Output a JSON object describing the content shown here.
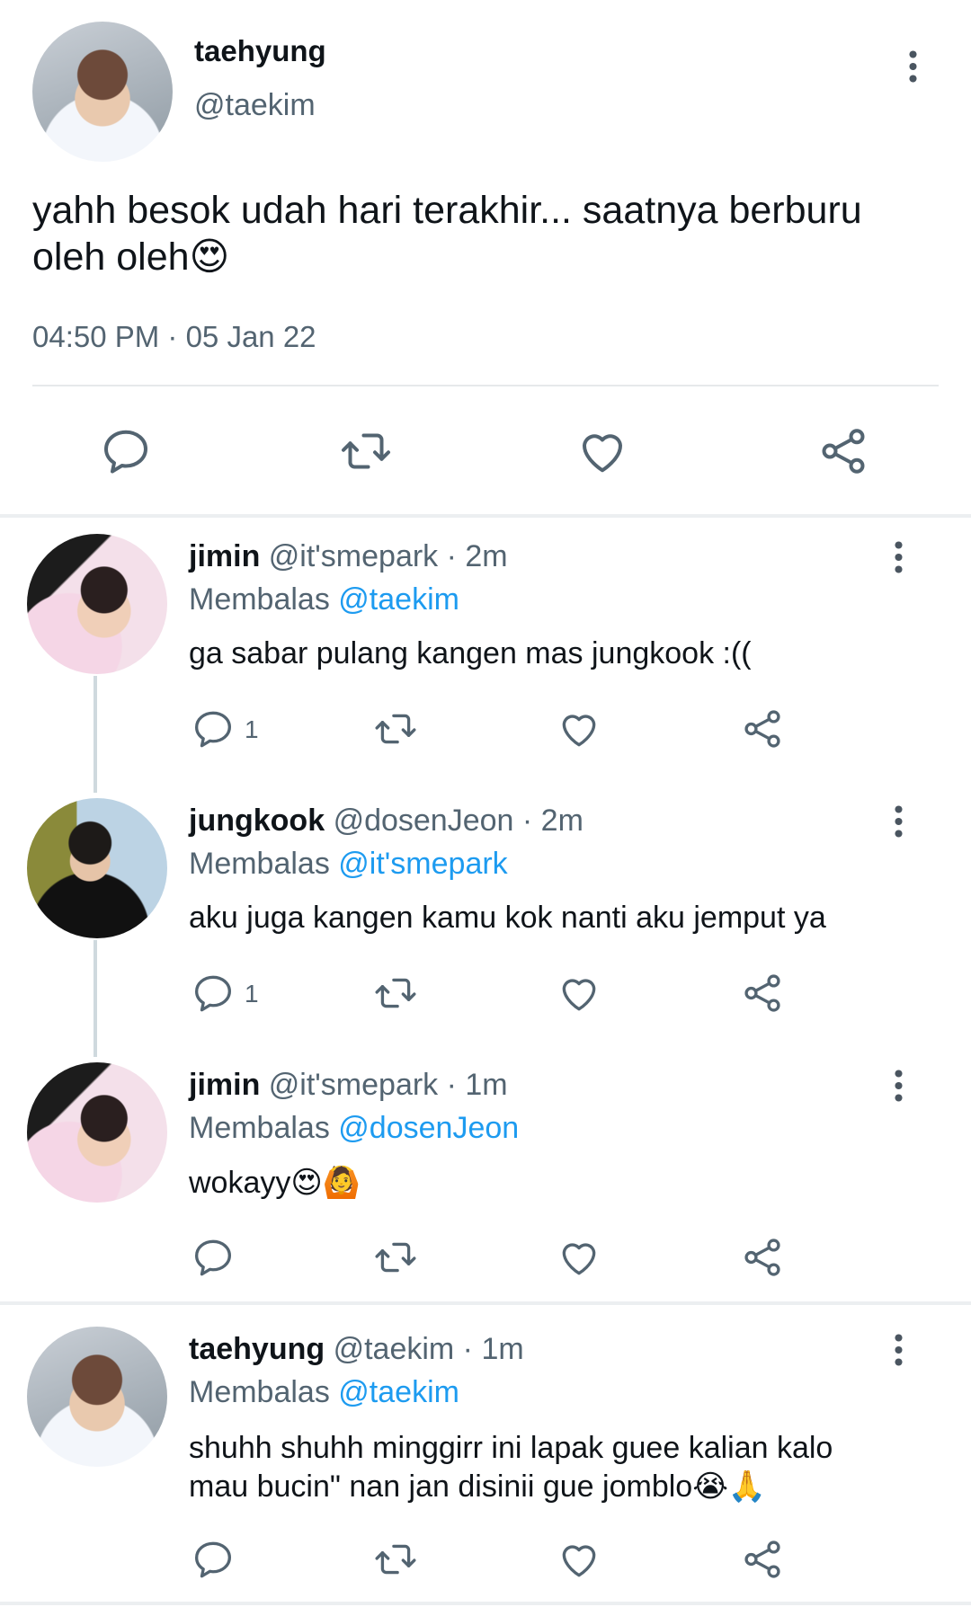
{
  "main_tweet": {
    "name": "taehyung",
    "handle": "@taekim",
    "text_line1": "yahh besok udah hari terakhir... saatnya berburu",
    "text_line2": "oleh oleh",
    "emoji": "😍",
    "timestamp": "04:50 PM · 05 Jan 22"
  },
  "replies": [
    {
      "name": "jimin",
      "meta": "@it'smepark · 2m",
      "replying_prefix": "Membalas",
      "replying_to": "@taekim",
      "text": "ga sabar pulang kangen mas jungkook :((",
      "reply_count": "1"
    },
    {
      "name": "jungkook",
      "meta": "@dosenJeon · 2m",
      "replying_prefix": "Membalas",
      "replying_to": "@it'smepark",
      "text": "aku juga kangen kamu kok nanti aku jemput ya",
      "reply_count": "1"
    },
    {
      "name": "jimin",
      "meta": "@it'smepark · 1m",
      "replying_prefix": "Membalas",
      "replying_to": "@dosenJeon",
      "text": "wokayy",
      "emoji": "😍🙆",
      "reply_count": ""
    },
    {
      "name": "taehyung",
      "meta": "@taekim · 1m",
      "replying_prefix": "Membalas",
      "replying_to": "@taekim",
      "text_line1": "shuhh shuhh minggirr ini lapak guee kalian kalo",
      "text_line2": "mau bucin\" nan jan disinii gue jomblo",
      "emoji": "😭🙏",
      "reply_count": ""
    }
  ],
  "colors": {
    "accent": "#1d9bf0",
    "muted": "#536471",
    "icon": "#536471"
  },
  "icons": [
    "more-vertical-icon",
    "reply-icon",
    "retweet-icon",
    "like-icon",
    "share-icon"
  ]
}
